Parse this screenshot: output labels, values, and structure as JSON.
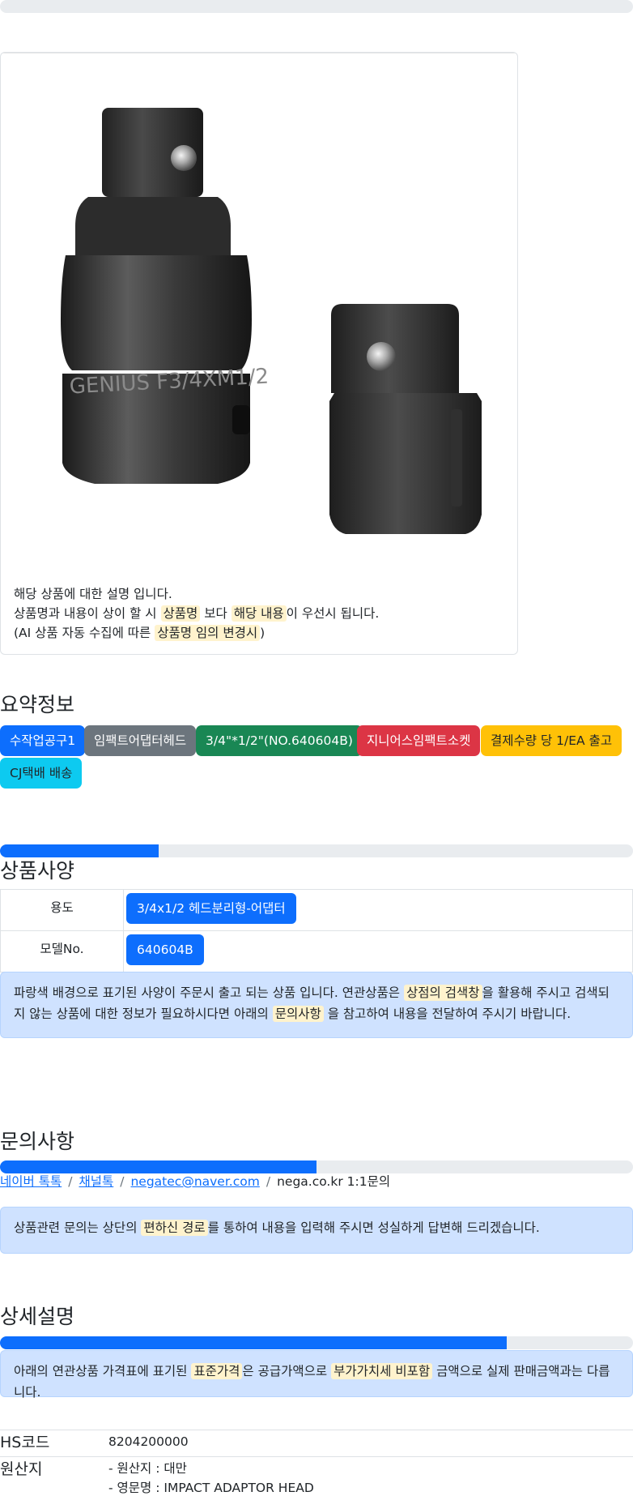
{
  "product_card": {
    "description_line1": "해당 상품에 대한 설명 입니다.",
    "line2_pre": "상품명과 내용이 상이 할 시",
    "line2_hl1": "상품명",
    "line2_mid": "보다",
    "line2_hl2": "해당 내용",
    "line2_post": "이 우선시 됩니다.",
    "line3_pre": "(AI 상품 자동 수집에 따른",
    "line3_hl": "상품명 임의 변경시",
    "line3_post": ")",
    "engraving": "GENIUS F3/4XM1/2"
  },
  "summary": {
    "title": "요약정보",
    "badges": [
      {
        "label": "수작업공구1",
        "color": "#0d6efd",
        "text_color": "#ffffff"
      },
      {
        "label": "임팩트어댑터헤드",
        "color": "#6c757d",
        "text_color": "#ffffff"
      },
      {
        "label": "3/4\"*1/2\"(NO.640604B)",
        "color": "#198754",
        "text_color": "#ffffff"
      },
      {
        "label": "지니어스임팩트소켓",
        "color": "#dc3545",
        "text_color": "#ffffff"
      },
      {
        "label": "결제수량 당 1/EA 출고",
        "color": "#ffc107",
        "text_color": "#212529"
      },
      {
        "label": "CJ택배 배송",
        "color": "#0dcaf0",
        "text_color": "#212529"
      }
    ]
  },
  "specs": {
    "title": "상품사양",
    "progress": 0.25,
    "rows": [
      {
        "key": "용도",
        "value": "3/4x1/2 헤드분리형-어댑터"
      },
      {
        "key": "모델No.",
        "value": "640604B"
      }
    ],
    "notice_pre": "파랑색 배경으로 표기된 사양이 주문시 출고 되는 상품 입니다. 연관상품은",
    "notice_hl1": "상점의 검색창",
    "notice_mid": "을 활용해 주시고 검색되지 않는 상품에 대한 정보가 필요하시다면 아래의",
    "notice_hl2": "문의사항",
    "notice_post": "을 참고하여 내용을 전달하여 주시기 바랍니다."
  },
  "inquiry": {
    "title": "문의사항",
    "progress": 0.5,
    "links": [
      "네이버 톡톡",
      "채널톡",
      "negatec@naver.com"
    ],
    "plain": "nega.co.kr 1:1문의",
    "separator": "/",
    "notice_pre": "상품관련 문의는 상단의",
    "notice_hl": "편하신 경로",
    "notice_post": "를 통하여 내용을 입력해 주시면 성실하게 답변해 드리겠습니다."
  },
  "detail": {
    "title": "상세설명",
    "progress": 0.8,
    "notice_pre": "아래의 연관상품 가격표에 표기된",
    "notice_hl1": "표준가격",
    "notice_mid": "은 공급가액으로",
    "notice_hl2": "부가가치세 비포함",
    "notice_post": "금액으로 실제 판매금액과는 다릅니다."
  },
  "info": {
    "hs_label": "HS코드",
    "hs_value": "8204200000",
    "origin_label": "원산지",
    "origin_line1": "- 원산지 : 대만",
    "origin_line2": "- 영문명 : IMPACT ADAPTOR HEAD"
  }
}
